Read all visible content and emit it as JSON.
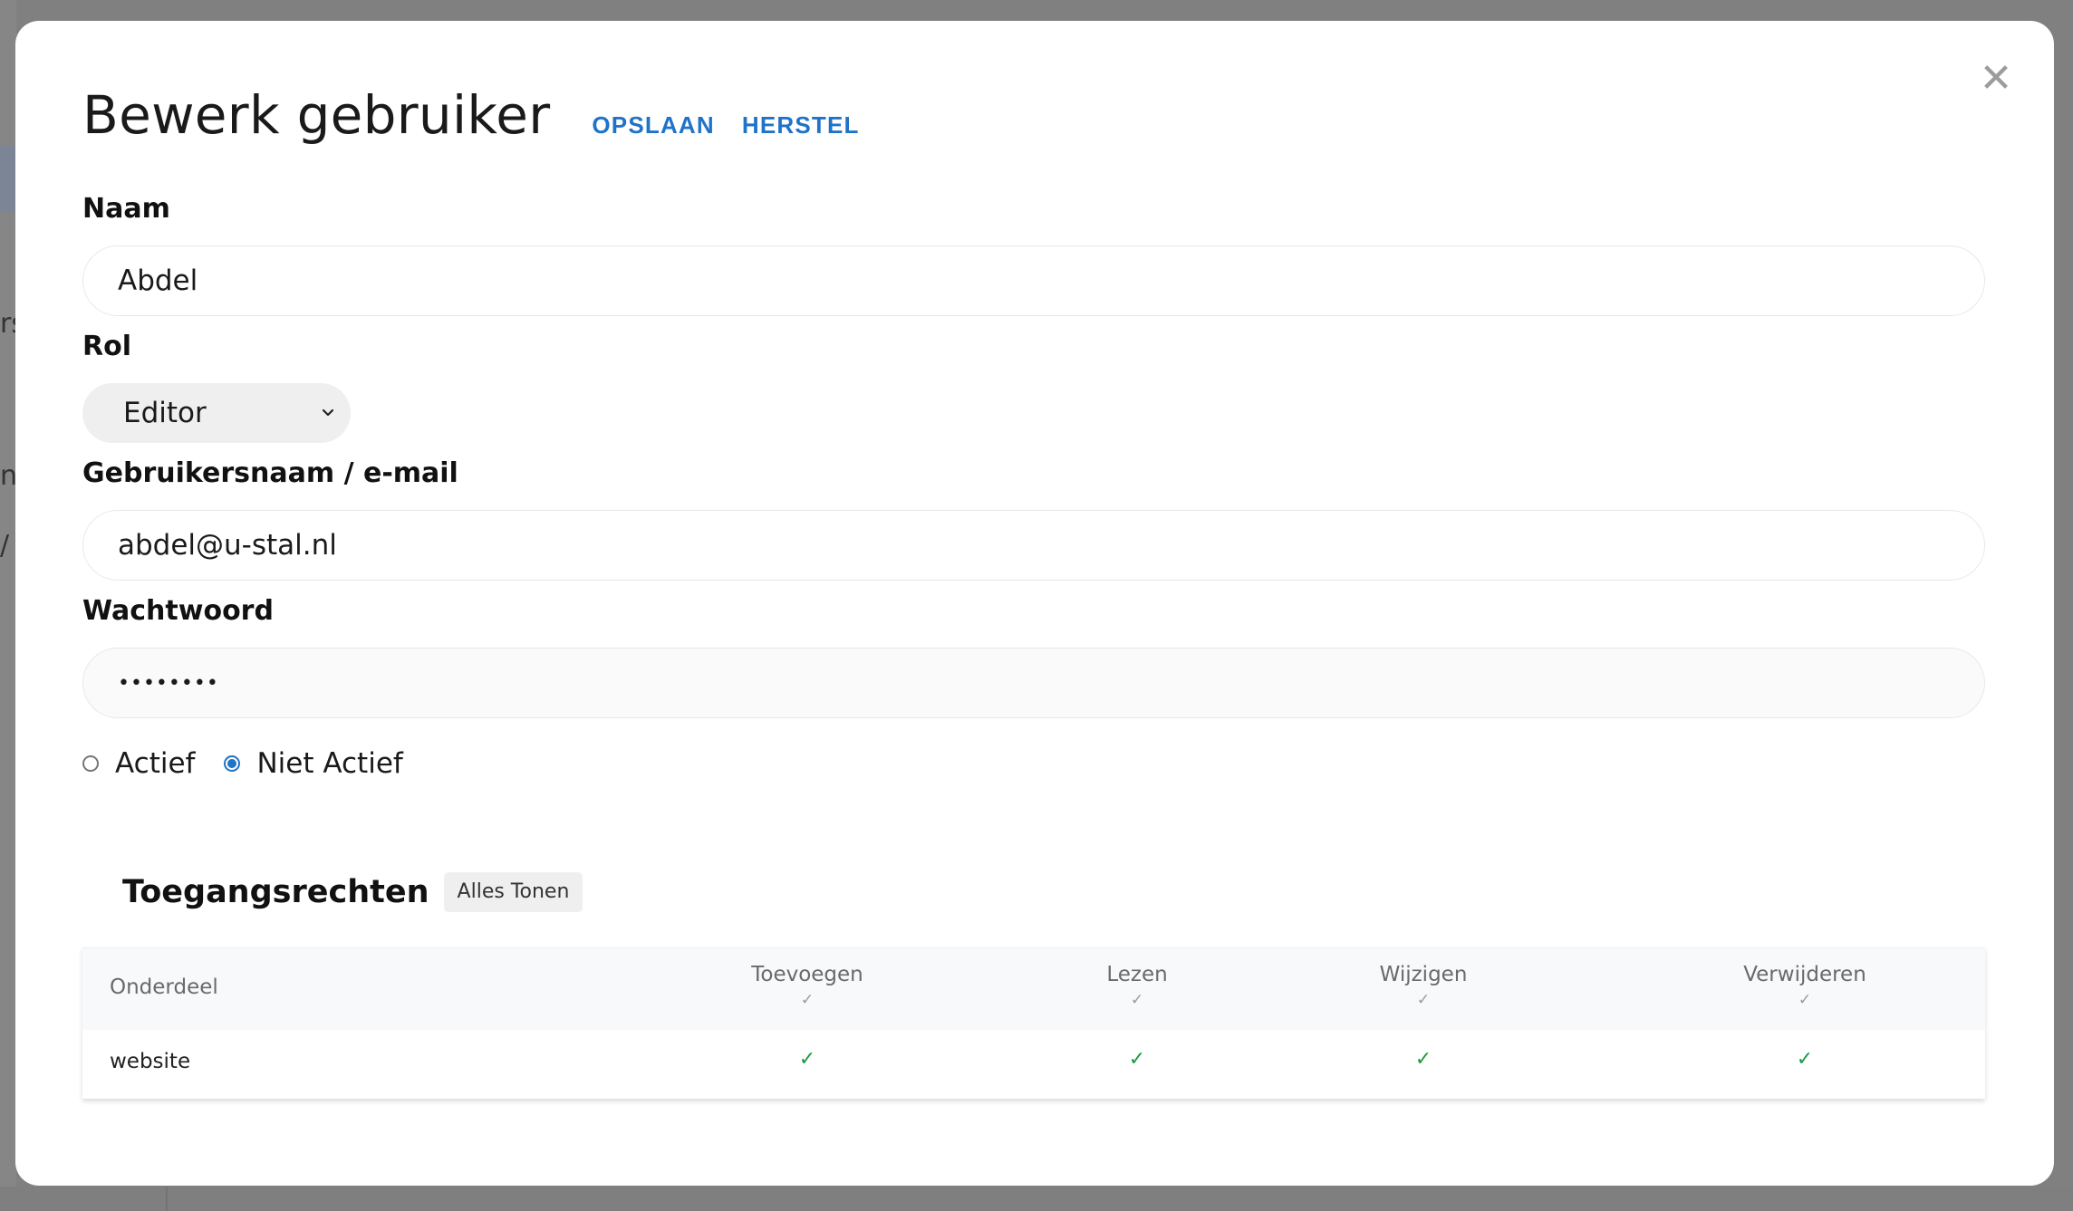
{
  "backdrop": {
    "glyphs": [
      "rs",
      "n",
      "/"
    ]
  },
  "modal": {
    "close_symbol": "✕",
    "title": "Bewerk gebruiker",
    "actions": {
      "save": "OPSLAAN",
      "reset": "HERSTEL"
    }
  },
  "form": {
    "name": {
      "label": "Naam",
      "value": "Abdel"
    },
    "role": {
      "label": "Rol",
      "selected": "Editor"
    },
    "username": {
      "label": "Gebruikersnaam / e-mail",
      "value": "abdel@u-stal.nl"
    },
    "password": {
      "label": "Wachtwoord",
      "value": "••••••••"
    },
    "status": {
      "options": [
        {
          "label": "Actief",
          "checked": false
        },
        {
          "label": "Niet Actief",
          "checked": true
        }
      ]
    }
  },
  "permissions": {
    "title": "Toegangsrechten",
    "show_all_label": "Alles Tonen",
    "columns": [
      "Onderdeel",
      "Toevoegen",
      "Lezen",
      "Wijzigen",
      "Verwijderen"
    ],
    "header_tick": "✓",
    "rows": [
      {
        "section": "website",
        "toevoegen": "✓",
        "lezen": "✓",
        "wijzigen": "✓",
        "verwijderen": "✓"
      }
    ]
  },
  "colors": {
    "accent": "#1f73c8",
    "check_green": "#1a9c3f",
    "overlay": "#808080"
  }
}
